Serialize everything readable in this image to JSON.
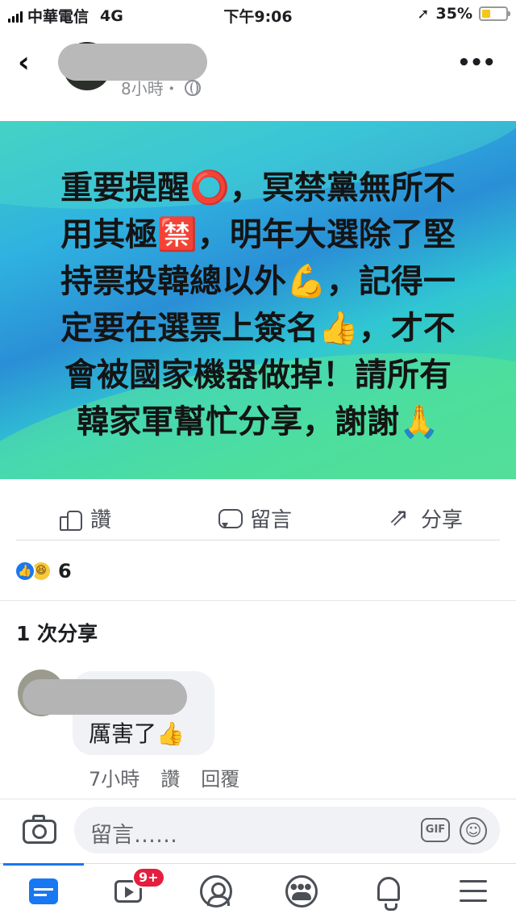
{
  "status_bar": {
    "carrier": "中華電信",
    "network": "4G",
    "time": "下午9:06",
    "battery": "35%",
    "battery_level": 0.35
  },
  "post": {
    "time": "8小時・",
    "banner_lines": [
      "重要提醒⭕，冥禁黨無所不",
      "用其極🈲，明年大選除了堅",
      "持票投韓總以外💪，記得一",
      "定要在選票上簽名👍，才不",
      "會被國家機器做掉！請所有",
      "韓家軍幫忙分享，謝謝🙏"
    ]
  },
  "actions": {
    "like": "讚",
    "comment": "留言",
    "share": "分享"
  },
  "reactions": {
    "count": "6",
    "like_glyph": "👍",
    "haha_glyph": "😆"
  },
  "shares": "1 次分享",
  "comment": {
    "text": "厲害了👍",
    "time": "7小時",
    "like": "讚",
    "reply": "回覆"
  },
  "composer": {
    "placeholder": "留言……",
    "gif": "GIF",
    "emoji_glyph": "☺"
  },
  "tabbar": {
    "watch_badge": "9+"
  },
  "header": {
    "back_glyph": "‹",
    "more_glyph": "•••"
  },
  "colors": {
    "accent": "#1877f2",
    "badge": "#e41e3f"
  }
}
